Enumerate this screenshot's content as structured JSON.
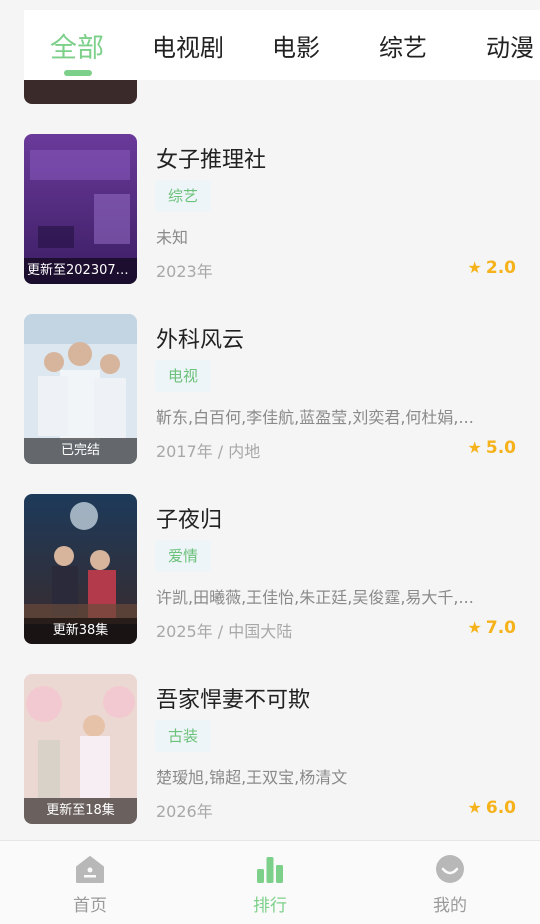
{
  "tabs": [
    {
      "label": "全部",
      "active": true
    },
    {
      "label": "电视剧",
      "active": false
    },
    {
      "label": "电影",
      "active": false
    },
    {
      "label": "综艺",
      "active": false
    },
    {
      "label": "动漫",
      "active": false
    }
  ],
  "items": [
    {
      "title": "女子推理社",
      "tag": "综艺",
      "cast": "未知",
      "meta": "2023年",
      "rating": "2.0",
      "status": "更新至2023071...",
      "poster_color": "#5b2d86"
    },
    {
      "title": "外科风云",
      "tag": "电视",
      "cast": "靳东,白百何,李佳航,蓝盈莹,刘奕君,何杜娟,...",
      "meta": "2017年 / 内地",
      "rating": "5.0",
      "status": "已完结",
      "poster_color": "#c9d8e6"
    },
    {
      "title": "子夜归",
      "tag": "爱情",
      "cast": "许凯,田曦薇,王佳怡,朱正廷,吴俊霆,易大千,...",
      "meta": "2025年 / 中国大陆",
      "rating": "7.0",
      "status": "更新38集",
      "poster_color": "#1f3550"
    },
    {
      "title": "吾家悍妻不可欺",
      "tag": "古装",
      "cast": "楚瑷旭,锦超,王双宝,杨清文",
      "meta": "2026年",
      "rating": "6.0",
      "status": "更新至18集",
      "poster_color": "#e7c9c4"
    }
  ],
  "nav": [
    {
      "label": "首页",
      "icon": "home-icon",
      "active": false
    },
    {
      "label": "排行",
      "icon": "ranking-icon",
      "active": true
    },
    {
      "label": "我的",
      "icon": "profile-icon",
      "active": false
    }
  ],
  "colors": {
    "accent": "#7dd08a",
    "rating": "#f5b21a",
    "tag_bg": "#eef5f8"
  }
}
